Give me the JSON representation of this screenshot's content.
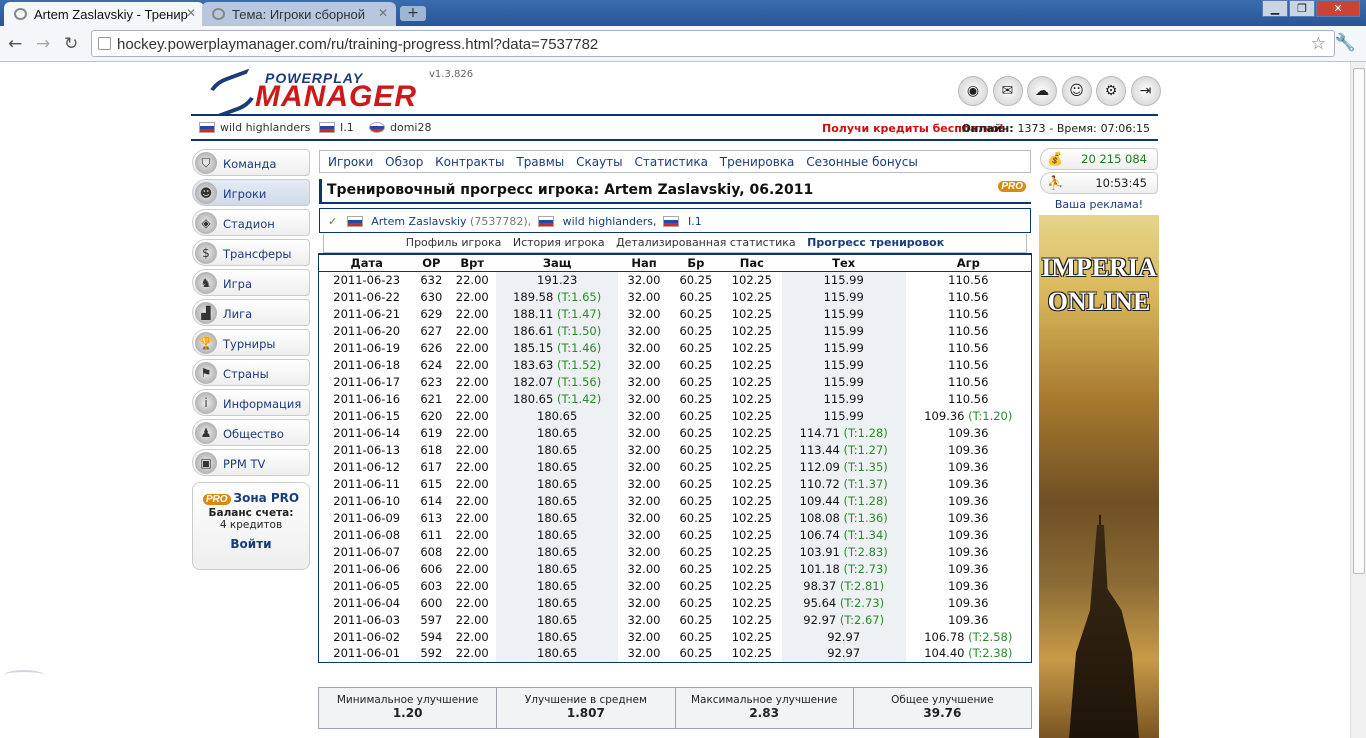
{
  "browser": {
    "tabs": [
      {
        "title": "Artem Zaslavskiy - Тренир"
      },
      {
        "title": "Тема: Игроки сборной"
      }
    ],
    "url": "hockey.powerplaymanager.com/ru/training-progress.html?data=7537782"
  },
  "header": {
    "logo_top": "POWERPLAY",
    "logo_main": "MANAGER",
    "version": "v1.3.826",
    "icons": [
      "ppm-icon",
      "mail-icon",
      "forum-icon",
      "friends-icon",
      "settings-icon",
      "logout-icon"
    ]
  },
  "infobar": {
    "team": "wild highlanders",
    "league": "I.1",
    "user": "domi28",
    "credits_link": "Получи кредиты бесплатно!",
    "online_label": "Онлайн:",
    "online_count": "1373",
    "time_label": "- Время:",
    "time": "07:06:15"
  },
  "sidebar": {
    "items": [
      {
        "label": "Команда"
      },
      {
        "label": "Игроки"
      },
      {
        "label": "Стадион"
      },
      {
        "label": "Трансферы"
      },
      {
        "label": "Игра"
      },
      {
        "label": "Лига"
      },
      {
        "label": "Турниры"
      },
      {
        "label": "Страны"
      },
      {
        "label": "Информация"
      },
      {
        "label": "Общество"
      },
      {
        "label": "PPM TV"
      }
    ],
    "pro_zone": {
      "badge": "PRO",
      "title": "Зона PRO",
      "balance_label": "Баланс счета:",
      "balance": "4 кредитов",
      "login": "Войти"
    }
  },
  "subnav": [
    "Игроки",
    "Обзор",
    "Контракты",
    "Травмы",
    "Скауты",
    "Статистика",
    "Тренировка",
    "Сезонные бонусы"
  ],
  "page": {
    "title": "Тренировочный прогресс игрока: Artem Zaslavskiy, 06.2011",
    "pro_badge": "PRO",
    "player_name": "Artem Zaslavskiy",
    "player_id": "(7537782),",
    "team": "wild highlanders,",
    "league": "I.1",
    "sublinks": [
      "Профиль игрока",
      "История игрока",
      "Детализированная статистика",
      "Прогресс тренировок"
    ]
  },
  "table": {
    "headers": [
      "Дата",
      "OP",
      "Врт",
      "Защ",
      "Нап",
      "Бр",
      "Пас",
      "Тех",
      "Агр"
    ],
    "rows": [
      [
        "2011-06-23",
        "632",
        "22.00",
        "191.23",
        "",
        "32.00",
        "60.25",
        "102.25",
        "115.99",
        "",
        "110.56",
        ""
      ],
      [
        "2011-06-22",
        "630",
        "22.00",
        "189.58",
        "(T:1.65)",
        "32.00",
        "60.25",
        "102.25",
        "115.99",
        "",
        "110.56",
        ""
      ],
      [
        "2011-06-21",
        "629",
        "22.00",
        "188.11",
        "(T:1.47)",
        "32.00",
        "60.25",
        "102.25",
        "115.99",
        "",
        "110.56",
        ""
      ],
      [
        "2011-06-20",
        "627",
        "22.00",
        "186.61",
        "(T:1.50)",
        "32.00",
        "60.25",
        "102.25",
        "115.99",
        "",
        "110.56",
        ""
      ],
      [
        "2011-06-19",
        "626",
        "22.00",
        "185.15",
        "(T:1.46)",
        "32.00",
        "60.25",
        "102.25",
        "115.99",
        "",
        "110.56",
        ""
      ],
      [
        "2011-06-18",
        "624",
        "22.00",
        "183.63",
        "(T:1.52)",
        "32.00",
        "60.25",
        "102.25",
        "115.99",
        "",
        "110.56",
        ""
      ],
      [
        "2011-06-17",
        "623",
        "22.00",
        "182.07",
        "(T:1.56)",
        "32.00",
        "60.25",
        "102.25",
        "115.99",
        "",
        "110.56",
        ""
      ],
      [
        "2011-06-16",
        "621",
        "22.00",
        "180.65",
        "(T:1.42)",
        "32.00",
        "60.25",
        "102.25",
        "115.99",
        "",
        "110.56",
        ""
      ],
      [
        "2011-06-15",
        "620",
        "22.00",
        "180.65",
        "",
        "32.00",
        "60.25",
        "102.25",
        "115.99",
        "",
        "109.36",
        "(T:1.20)"
      ],
      [
        "2011-06-14",
        "619",
        "22.00",
        "180.65",
        "",
        "32.00",
        "60.25",
        "102.25",
        "114.71",
        "(T:1.28)",
        "109.36",
        ""
      ],
      [
        "2011-06-13",
        "618",
        "22.00",
        "180.65",
        "",
        "32.00",
        "60.25",
        "102.25",
        "113.44",
        "(T:1.27)",
        "109.36",
        ""
      ],
      [
        "2011-06-12",
        "617",
        "22.00",
        "180.65",
        "",
        "32.00",
        "60.25",
        "102.25",
        "112.09",
        "(T:1.35)",
        "109.36",
        ""
      ],
      [
        "2011-06-11",
        "615",
        "22.00",
        "180.65",
        "",
        "32.00",
        "60.25",
        "102.25",
        "110.72",
        "(T:1.37)",
        "109.36",
        ""
      ],
      [
        "2011-06-10",
        "614",
        "22.00",
        "180.65",
        "",
        "32.00",
        "60.25",
        "102.25",
        "109.44",
        "(T:1.28)",
        "109.36",
        ""
      ],
      [
        "2011-06-09",
        "613",
        "22.00",
        "180.65",
        "",
        "32.00",
        "60.25",
        "102.25",
        "108.08",
        "(T:1.36)",
        "109.36",
        ""
      ],
      [
        "2011-06-08",
        "611",
        "22.00",
        "180.65",
        "",
        "32.00",
        "60.25",
        "102.25",
        "106.74",
        "(T:1.34)",
        "109.36",
        ""
      ],
      [
        "2011-06-07",
        "608",
        "22.00",
        "180.65",
        "",
        "32.00",
        "60.25",
        "102.25",
        "103.91",
        "(T:2.83)",
        "109.36",
        ""
      ],
      [
        "2011-06-06",
        "606",
        "22.00",
        "180.65",
        "",
        "32.00",
        "60.25",
        "102.25",
        "101.18",
        "(T:2.73)",
        "109.36",
        ""
      ],
      [
        "2011-06-05",
        "603",
        "22.00",
        "180.65",
        "",
        "32.00",
        "60.25",
        "102.25",
        "98.37",
        "(T:2.81)",
        "109.36",
        ""
      ],
      [
        "2011-06-04",
        "600",
        "22.00",
        "180.65",
        "",
        "32.00",
        "60.25",
        "102.25",
        "95.64",
        "(T:2.73)",
        "109.36",
        ""
      ],
      [
        "2011-06-03",
        "597",
        "22.00",
        "180.65",
        "",
        "32.00",
        "60.25",
        "102.25",
        "92.97",
        "(T:2.67)",
        "109.36",
        ""
      ],
      [
        "2011-06-02",
        "594",
        "22.00",
        "180.65",
        "",
        "32.00",
        "60.25",
        "102.25",
        "92.97",
        "",
        "106.78",
        "(T:2.58)"
      ],
      [
        "2011-06-01",
        "592",
        "22.00",
        "180.65",
        "",
        "32.00",
        "60.25",
        "102.25",
        "92.97",
        "",
        "104.40",
        "(T:2.38)"
      ]
    ]
  },
  "summary": [
    {
      "label": "Минимальное улучшение",
      "value": "1.20"
    },
    {
      "label": "Улучшение в среднем",
      "value": "1.807"
    },
    {
      "label": "Максимальное улучшение",
      "value": "2.83"
    },
    {
      "label": "Общее улучшение",
      "value": "39.76"
    }
  ],
  "right": {
    "money": "20 215 084",
    "clock": "10:53:45",
    "ad_label": "Ваша реклама!",
    "ad_text_1": "IMPERIA",
    "ad_text_2": "ONLINE"
  },
  "colors": {
    "navy": "#0e3570",
    "link": "#1a3d7a",
    "green": "#2a8a2a",
    "red": "#d01010"
  }
}
